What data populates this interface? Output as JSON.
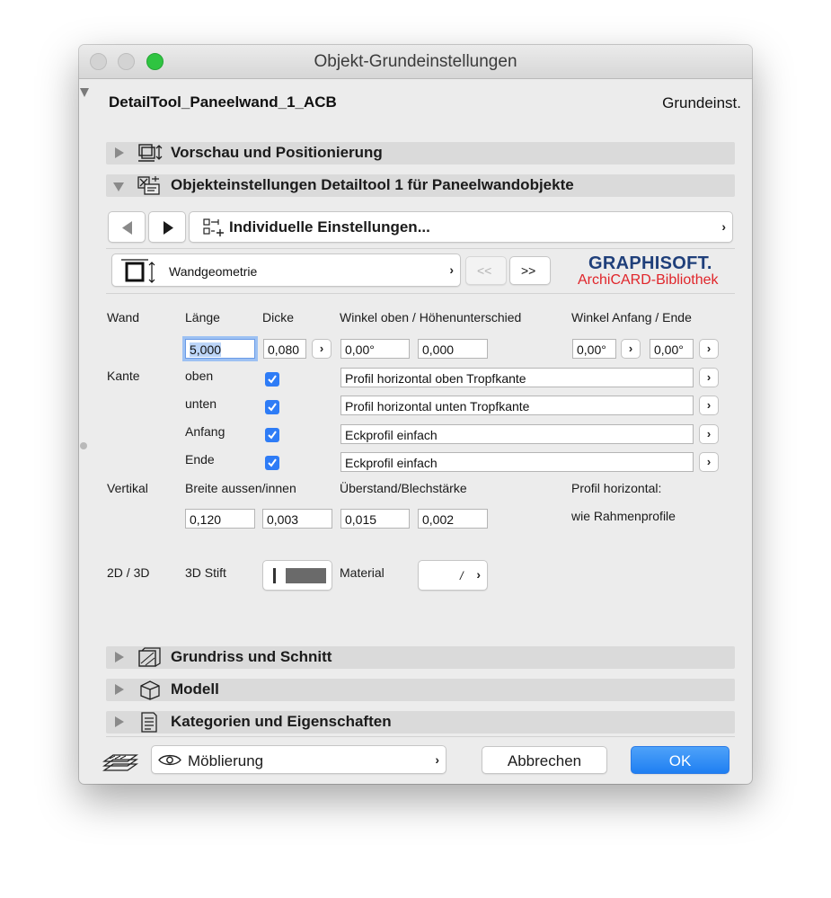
{
  "window": {
    "title": "Objekt-Grundeinstellungen"
  },
  "header": {
    "object_name": "DetailTool_Paneelwand_1_ACB",
    "grundeinst": "Grundeinst."
  },
  "sections": {
    "vorschau": "Vorschau und Positionierung",
    "objekteinstellungen": "Objekteinstellungen Detailtool 1 für Paneelwandobjekte",
    "grundriss": "Grundriss und Schnitt",
    "modell": "Modell",
    "kategorien": "Kategorien und Eigenschaften"
  },
  "nav": {
    "page_label": "Individuelle Einstellungen..."
  },
  "subpage": {
    "label": "Wandgeometrie",
    "prev_label": "<<",
    "next_label": ">>"
  },
  "logo": {
    "line1": "GRAPHISOFT.",
    "line2": "ArchiCARD-Bibliothek"
  },
  "form": {
    "wand_label": "Wand",
    "laenge_label": "Länge",
    "dicke_label": "Dicke",
    "winkel_label": "Winkel oben / Höhenunterschied",
    "winkel_anfang_label": "Winkel Anfang / Ende",
    "laenge_value": "5,000",
    "dicke_value": "0,080",
    "winkel_oben_value": "0,00°",
    "hoehe_value": "0,000",
    "winkel_anfang_value": "0,00°",
    "winkel_ende_value": "0,00°",
    "kante_label": "Kante",
    "kanten": [
      {
        "label": "oben",
        "checked": true,
        "profile": "Profil horizontal oben Tropfkante"
      },
      {
        "label": "unten",
        "checked": true,
        "profile": "Profil horizontal unten Tropfkante"
      },
      {
        "label": "Anfang",
        "checked": true,
        "profile": "Eckprofil einfach"
      },
      {
        "label": "Ende",
        "checked": true,
        "profile": "Eckprofil einfach"
      }
    ],
    "vertikal_label": "Vertikal",
    "breite_label": "Breite aussen/innen",
    "ueberstand_label": "Überstand/Blechstärke",
    "profil_label": "Profil horizontal:",
    "breite_aussen": "0,120",
    "breite_innen": "0,003",
    "ueberstand": "0,015",
    "blechstaerke": "0,002",
    "profil_value": "wie Rahmenprofile",
    "label_2d3d": "2D / 3D",
    "stift_label": "3D Stift",
    "material_label": "Material",
    "material_value": "/"
  },
  "footer": {
    "layer_label": "Möblierung",
    "cancel_label": "Abbrechen",
    "ok_label": "OK"
  },
  "colors": {
    "accent": "#2e7cf6",
    "ok_button": "#2f8cf6",
    "traffic_green": "#2fc441",
    "logo_blue": "#1f3f7a",
    "logo_red": "#e0252a"
  }
}
